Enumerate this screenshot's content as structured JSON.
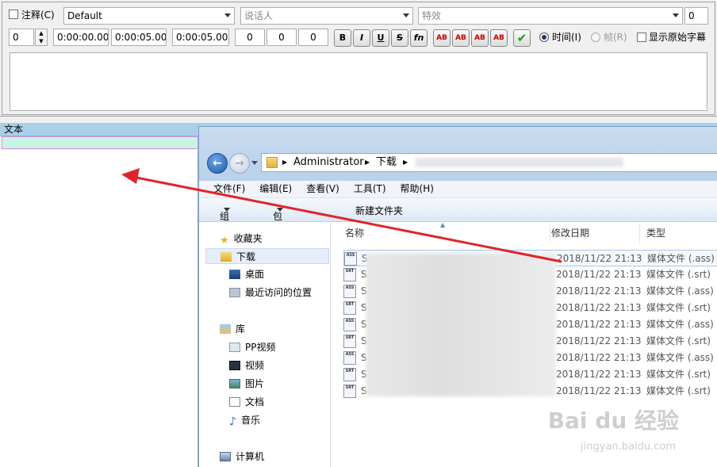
{
  "toolbar": {
    "comment_label": "注释(C)",
    "style_value": "Default",
    "actor_placeholder": "说话人",
    "effect_placeholder": "特效",
    "layer_value": "0",
    "row2": {
      "layer": "0",
      "start_time": "0:00:00.00",
      "end_time": "0:00:05.00",
      "duration": "0:00:05.00",
      "margin_l": "0",
      "margin_r": "0",
      "margin_v": "0"
    },
    "format_buttons": [
      "B",
      "I",
      "U",
      "S",
      "fn"
    ],
    "color_buttons": [
      "AB",
      "AB",
      "AB",
      "AB"
    ],
    "time_radio_label": "时间(I)",
    "frame_radio_label": "帧(R)",
    "show_original_label": "显示原始字幕"
  },
  "grid": {
    "header": "文本"
  },
  "explorer": {
    "breadcrumb": [
      "Administrator",
      "下载"
    ],
    "menu": [
      "文件(F)",
      "编辑(E)",
      "查看(V)",
      "工具(T)",
      "帮助(H)"
    ],
    "commands": [
      "组织",
      "包含到库中",
      "新建文件夹"
    ],
    "nav": {
      "favorites_header": "收藏夹",
      "favorites": [
        "下载",
        "桌面",
        "最近访问的位置"
      ],
      "libraries_header": "库",
      "libraries": [
        "PP视频",
        "视频",
        "图片",
        "文档",
        "音乐"
      ],
      "computer": "计算机"
    },
    "columns": [
      "名称",
      "修改日期",
      "类型"
    ],
    "files": [
      {
        "icon": "ASS",
        "name": "S",
        "date": "2018/11/22 21:13",
        "type": "媒体文件 (.ass)"
      },
      {
        "icon": "SRT",
        "name": "S",
        "date": "2018/11/22 21:13",
        "type": "媒体文件 (.srt)"
      },
      {
        "icon": "ASS",
        "name": "S",
        "date": "2018/11/22 21:13",
        "type": "媒体文件 (.ass)"
      },
      {
        "icon": "SRT",
        "name": "S",
        "date": "2018/11/22 21:13",
        "type": "媒体文件 (.srt)"
      },
      {
        "icon": "ASS",
        "name": "S",
        "date": "2018/11/22 21:13",
        "type": "媒体文件 (.ass)"
      },
      {
        "icon": "SRT",
        "name": "S",
        "date": "2018/11/22 21:13",
        "type": "媒体文件 (.srt)"
      },
      {
        "icon": "ASS",
        "name": "S",
        "date": "2018/11/22 21:13",
        "type": "媒体文件 (.ass)"
      },
      {
        "icon": "SRT",
        "name": "S",
        "date": "2018/11/22 21:13",
        "type": "媒体文件 (.srt)"
      },
      {
        "icon": "SRT",
        "name": "S",
        "date": "2018/11/22 21:13",
        "type": "媒体文件 (.srt)"
      }
    ]
  },
  "watermark": {
    "main": "Bai du 经验",
    "sub": "jingyan.baidu.com"
  },
  "colors": {
    "arrow": "#e0252a",
    "grid_header": "#a8d0e6",
    "grid_row": "#c8f5e3"
  }
}
